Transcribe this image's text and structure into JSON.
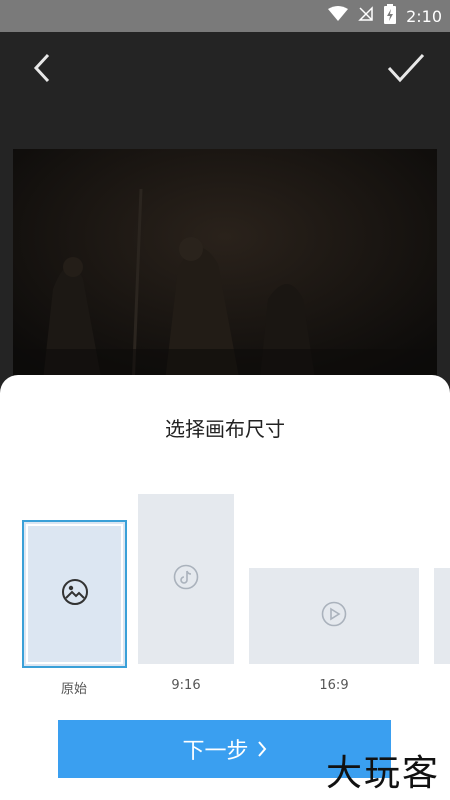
{
  "status": {
    "time": "2:10"
  },
  "sheet": {
    "title": "选择画布尺寸",
    "options": [
      {
        "label": "原始",
        "icon": "image-icon",
        "selected": true
      },
      {
        "label": "9:16",
        "icon": "tiktok-icon",
        "selected": false
      },
      {
        "label": "16:9",
        "icon": "play-icon",
        "selected": false
      }
    ],
    "next_label": "下一步"
  },
  "watermark": "大玩客",
  "colors": {
    "accent": "#3a9ff0",
    "selected_border": "#3aa0d8",
    "option_bg": "#e5e9ee"
  }
}
